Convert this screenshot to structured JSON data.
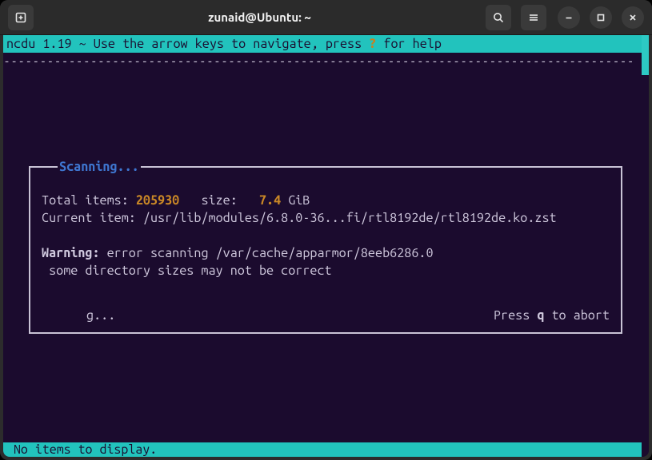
{
  "titlebar": {
    "title": "zunaid@Ubuntu: ~"
  },
  "header": {
    "left": "ncdu 1.19 ~ Use the arrow keys to navigate, press ",
    "help_key": "?",
    "right": " for help"
  },
  "dashes": "---------------------------------------------------------------------------------------",
  "dialog": {
    "title": "Scanning...",
    "total_items_label": "Total items: ",
    "total_items_value": "205930",
    "size_label": "   size:   ",
    "size_value": "7.4",
    "size_unit": " GiB",
    "current_item_label": "Current item: ",
    "current_item_path": "/usr/lib/modules/6.8.0-36...fi/rtl8192de/rtl8192de.ko.zst",
    "warning_label": "Warning:",
    "warning_text": " error scanning /var/cache/apparmor/8eeb6286.0",
    "warning_note": " some directory sizes may not be correct",
    "graph_hint": "g...",
    "abort_prefix": "Press ",
    "abort_key": "q",
    "abort_suffix": " to abort"
  },
  "footer": {
    "text": " No items to display."
  }
}
